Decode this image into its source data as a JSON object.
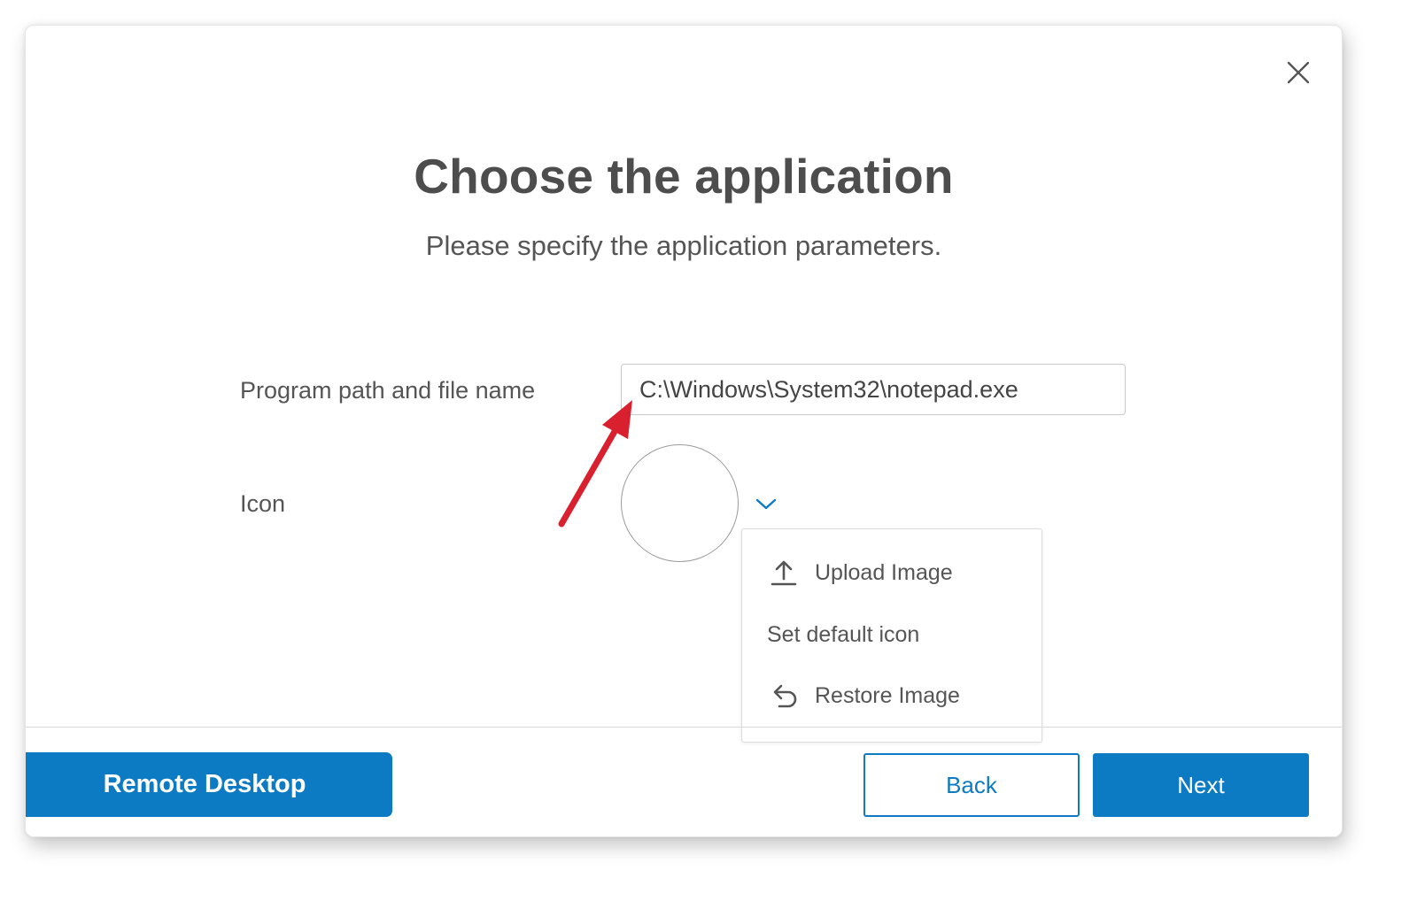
{
  "dialog": {
    "title": "Choose the application",
    "subtitle": "Please specify the application parameters."
  },
  "form": {
    "path_label": "Program path and file name",
    "path_value": "C:\\Windows\\System32\\notepad.exe",
    "icon_label": "Icon"
  },
  "icon_menu": {
    "items": [
      {
        "label": "Upload Image",
        "icon": "upload-icon"
      },
      {
        "label": "Set default icon",
        "icon": ""
      },
      {
        "label": "Restore Image",
        "icon": "restore-icon"
      }
    ]
  },
  "footer": {
    "remote_desktop_label": "Remote Desktop",
    "back_label": "Back",
    "next_label": "Next"
  },
  "colors": {
    "accent": "#0d7bc4",
    "annotation_arrow": "#d9202e"
  }
}
